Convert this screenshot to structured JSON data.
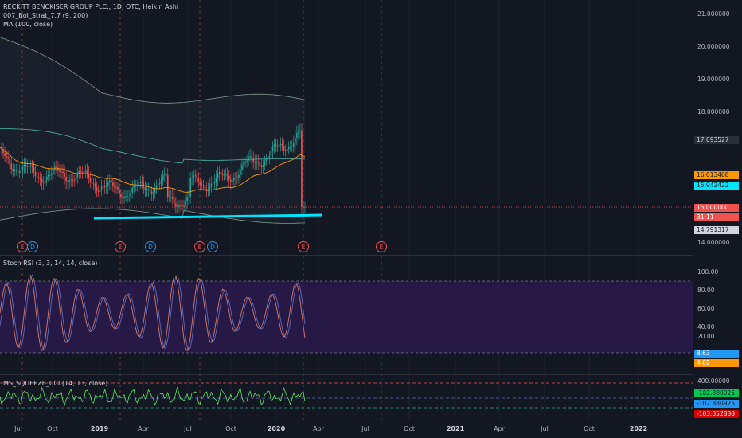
{
  "header": {
    "symbol_line": "RECKITT BENCKISER GROUP PLC., 1D, OTC, Heikin Ashi",
    "indicator_1": "007_Bol_Strat_7.7 (9, 200)",
    "indicator_2": "MA (100, close)",
    "stoch_title": "Stoch RSI (3, 3, 14, 14, close)",
    "cci_title": "MS_SQUEEZE_CCI (14, 13, close)"
  },
  "price_axis": {
    "labels": [
      "21.000000",
      "20.000000",
      "19.000000",
      "18.000000",
      "14.000000"
    ],
    "tags": {
      "bb_upper": "17.093527",
      "ma": "16.013408",
      "bb_mid": "15.942422",
      "last": "15.000000",
      "countdown": "31:11",
      "bb_lower": "14.791317"
    }
  },
  "stoch_axis": {
    "labels": [
      "100.00",
      "80.00",
      "60.00",
      "40.00",
      "20.00"
    ],
    "tag_k": "8.63",
    "tag_d": "4.02"
  },
  "cci_axis": {
    "label_top": "400.00000",
    "tag_1": "-102.880925",
    "tag_2": "-102.880925",
    "tag_3": "-103.052838"
  },
  "time_axis": {
    "labels": [
      "Jul",
      "Oct",
      "2019",
      "Apr",
      "Jul",
      "Oct",
      "2020",
      "Apr",
      "Jul",
      "Oct",
      "2021",
      "Apr",
      "Jul",
      "Oct",
      "2022"
    ],
    "year_labels": [
      "2019",
      "2020",
      "2021",
      "2022"
    ]
  },
  "earnings_markers": [
    "E",
    "D",
    "E",
    "D",
    "E",
    "D",
    "E",
    "E"
  ],
  "colors": {
    "background": "#131722",
    "candle_up": "#26a69a",
    "candle_down": "#ef5350",
    "ma_line": "#ff9800",
    "bb_band": "#787b86",
    "support_line": "#00e5ff",
    "stoch_fill": "#2a1a4a",
    "stoch_k": "#ff8a65",
    "stoch_d": "#5c6bc0",
    "cci_line": "#66ff66"
  },
  "chart_data": {
    "type": "candlestick",
    "title": "RECKITT BENCKISER GROUP PLC., 1D, OTC, Heikin Ashi",
    "ylim": [
      13.6,
      21.3
    ],
    "x_range": [
      "2018-06",
      "2022-06"
    ],
    "current_price": 15.0,
    "moving_average_last": 16.013408,
    "bollinger_upper_last": 17.093527,
    "bollinger_mid_last": 15.942422,
    "bollinger_lower_last": 14.791317,
    "support_line": {
      "start": [
        "2018-12",
        14.7
      ],
      "end": [
        "2020-04",
        14.9
      ]
    },
    "stoch_rsi": {
      "ylim": [
        0,
        110
      ],
      "k_last": 8.63,
      "d_last": 4.02,
      "bands": [
        90,
        10
      ]
    },
    "cci": {
      "last": -102.880925
    }
  }
}
